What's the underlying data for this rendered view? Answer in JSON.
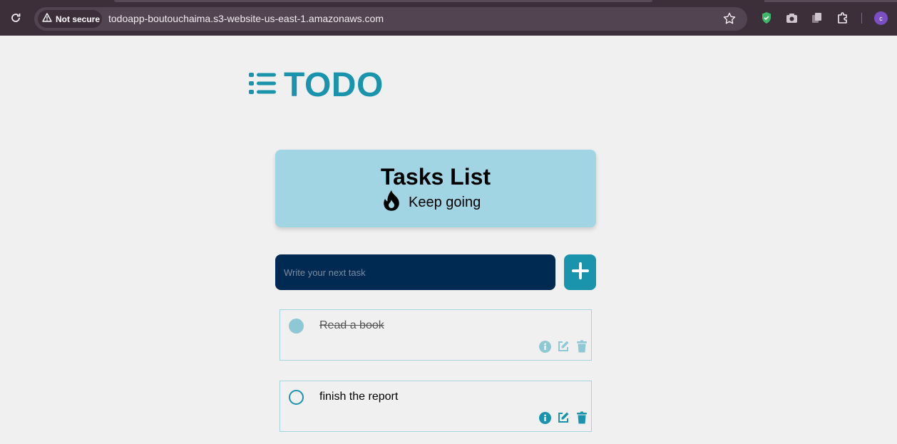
{
  "browser": {
    "security_label": "Not secure",
    "url": "todoapp-boutouchaima.s3-website-us-east-1.amazonaws.com",
    "profile_initial": "c"
  },
  "app": {
    "logo_text": "TODO",
    "accent_color": "#1a93ad",
    "header": {
      "title": "Tasks List",
      "subtitle": "Keep going",
      "background": "#a2d5e3"
    },
    "input": {
      "placeholder": "Write your next task",
      "value": ""
    },
    "tasks": [
      {
        "name": "Read a book",
        "completed": true
      },
      {
        "name": "finish the report",
        "completed": false
      }
    ]
  }
}
